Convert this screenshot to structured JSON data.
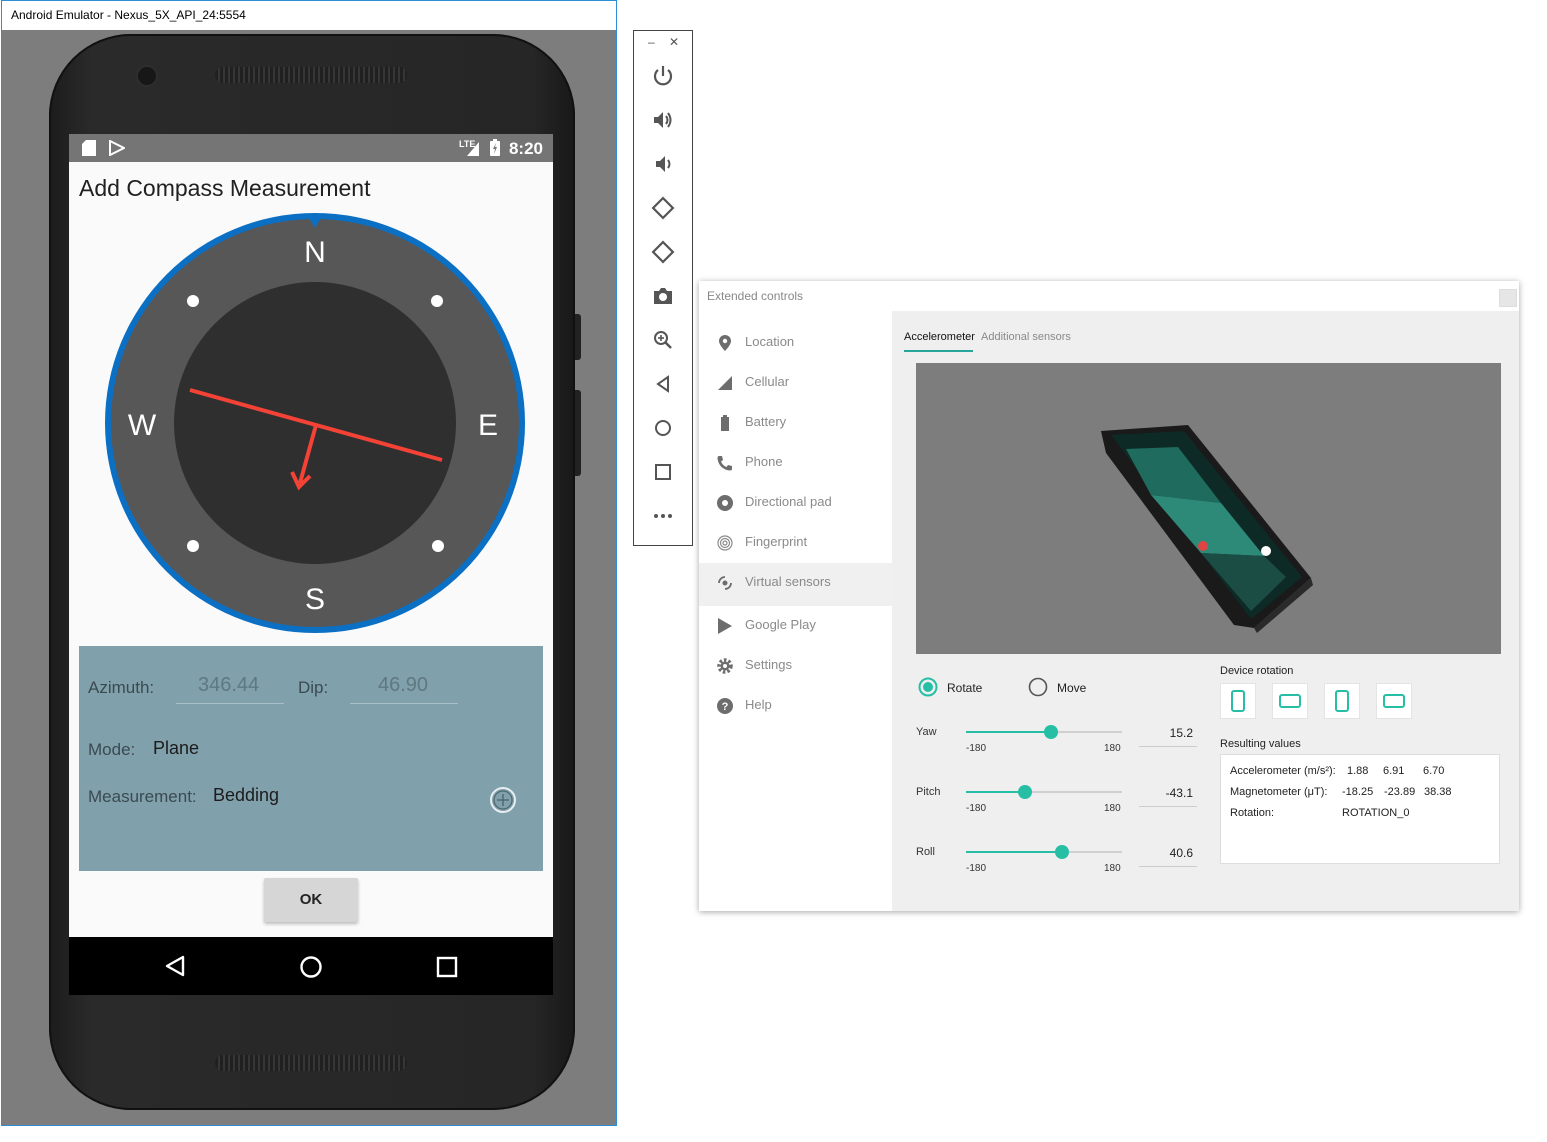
{
  "emulator": {
    "window_title": "Android Emulator - Nexus_5X_API_24:5554",
    "status_bar": {
      "time": "8:20",
      "network": "LTE"
    },
    "app": {
      "title": "Add Compass Measurement",
      "compass": {
        "north": "N",
        "south": "S",
        "east": "E",
        "west": "W",
        "needle_color": "#f44336",
        "ring_color": "#0b6fc4"
      },
      "form": {
        "azimuth_label": "Azimuth:",
        "azimuth_value": "346.44",
        "dip_label": "Dip:",
        "dip_value": "46.90",
        "mode_label": "Mode:",
        "mode_value": "Plane",
        "measurement_label": "Measurement:",
        "measurement_value": "Bedding"
      },
      "ok_label": "OK"
    },
    "nav_buttons": [
      "back-icon",
      "home-icon",
      "recents-icon"
    ]
  },
  "toolbar": {
    "icons": [
      "power-icon",
      "volume-up-icon",
      "volume-down-icon",
      "rotate-left-icon",
      "rotate-right-icon",
      "camera-icon",
      "zoom-icon",
      "back-icon",
      "home-icon",
      "overview-icon",
      "more-icon"
    ]
  },
  "extended": {
    "title": "Extended controls",
    "nav": [
      {
        "label": "Location",
        "icon": "location-icon"
      },
      {
        "label": "Cellular",
        "icon": "cellular-icon"
      },
      {
        "label": "Battery",
        "icon": "battery-icon"
      },
      {
        "label": "Phone",
        "icon": "phone-icon"
      },
      {
        "label": "Directional pad",
        "icon": "dpad-icon"
      },
      {
        "label": "Fingerprint",
        "icon": "fingerprint-icon"
      },
      {
        "label": "Virtual sensors",
        "icon": "virtual-sensors-icon"
      },
      {
        "label": "Google Play",
        "icon": "google-play-icon"
      },
      {
        "label": "Settings",
        "icon": "settings-icon"
      },
      {
        "label": "Help",
        "icon": "help-icon"
      }
    ],
    "tabs": {
      "accelerometer": "Accelerometer",
      "additional": "Additional sensors"
    },
    "mode": {
      "rotate": "Rotate",
      "move": "Move",
      "selected": "Rotate"
    },
    "sliders": [
      {
        "label": "Yaw",
        "min_label": "-180",
        "max_label": "180",
        "value": 15.2,
        "display": "15.2"
      },
      {
        "label": "Pitch",
        "min_label": "-180",
        "max_label": "180",
        "value": -43.1,
        "display": "-43.1"
      },
      {
        "label": "Roll",
        "min_label": "-180",
        "max_label": "180",
        "value": 40.6,
        "display": "40.6"
      }
    ],
    "device_rotation_label": "Device rotation",
    "resulting_label": "Resulting values",
    "results": {
      "accel_label": "Accelerometer (m/s²):",
      "accel": [
        "1.88",
        "6.91",
        "6.70"
      ],
      "mag_label": "Magnetometer (μT):",
      "mag": [
        "-18.25",
        "-23.89",
        "38.38"
      ],
      "rot_label": "Rotation:",
      "rot_value": "ROTATION_0"
    },
    "accent_color": "#26bfa5"
  }
}
